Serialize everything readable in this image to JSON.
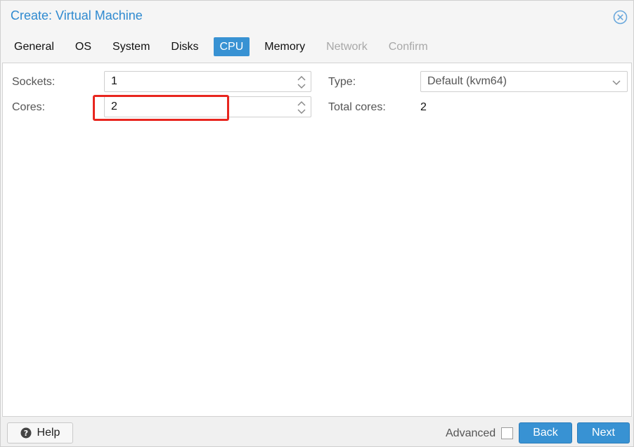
{
  "window": {
    "title": "Create: Virtual Machine"
  },
  "tabs": [
    {
      "label": "General",
      "state": "normal"
    },
    {
      "label": "OS",
      "state": "normal"
    },
    {
      "label": "System",
      "state": "normal"
    },
    {
      "label": "Disks",
      "state": "normal"
    },
    {
      "label": "CPU",
      "state": "active"
    },
    {
      "label": "Memory",
      "state": "normal"
    },
    {
      "label": "Network",
      "state": "disabled"
    },
    {
      "label": "Confirm",
      "state": "disabled"
    }
  ],
  "form": {
    "sockets_label": "Sockets:",
    "sockets_value": "1",
    "cores_label": "Cores:",
    "cores_value": "2",
    "type_label": "Type:",
    "type_value": "Default (kvm64)",
    "total_cores_label": "Total cores:",
    "total_cores_value": "2"
  },
  "footer": {
    "help_label": "Help",
    "advanced_label": "Advanced",
    "advanced_checked": false,
    "back_label": "Back",
    "next_label": "Next"
  },
  "colors": {
    "accent": "#3892d3",
    "title": "#2f8ad0",
    "highlight": "#e8261f"
  },
  "icons": {
    "close": "close-circle-icon",
    "help": "question-circle-icon",
    "spinner": "spinner-arrows-icon",
    "dropdown": "chevron-down-icon"
  }
}
